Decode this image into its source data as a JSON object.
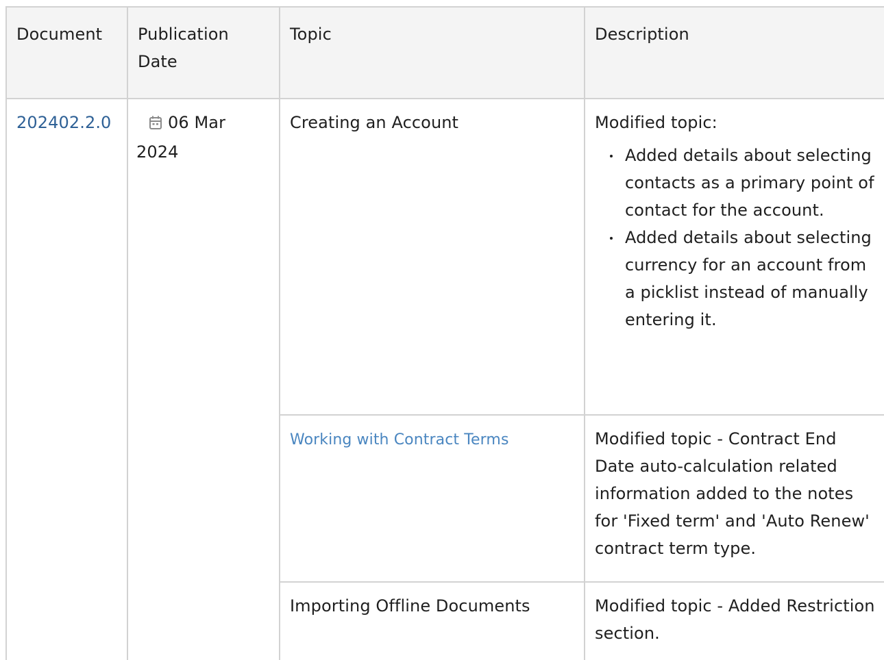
{
  "table": {
    "headers": [
      "Document",
      "Publication Date",
      "Topic",
      "Description"
    ],
    "document": "202402.2.0",
    "publication_date": "06 Mar 2024",
    "rows": [
      {
        "topic": "Creating an Account",
        "description_intro": "Modified topic:",
        "description_items": [
          "Added details about selecting contacts as a primary point of contact for the account.",
          "Added details about selecting currency for an account from a picklist instead of manually entering it."
        ]
      },
      {
        "topic": "Working with Contract Terms",
        "description": "Modified topic - Contract End Date auto-calculation related information added to the notes for 'Fixed term' and 'Auto Renew' contract term type."
      },
      {
        "topic": "Importing Offline Documents",
        "description": "Modified topic - Added Restriction section."
      }
    ]
  },
  "colors": {
    "link": "#2f6196",
    "link_light": "#4a86c0",
    "border": "#d2d2d2",
    "header_bg": "#f4f4f4"
  },
  "icons": {
    "date": "calendar-icon"
  }
}
